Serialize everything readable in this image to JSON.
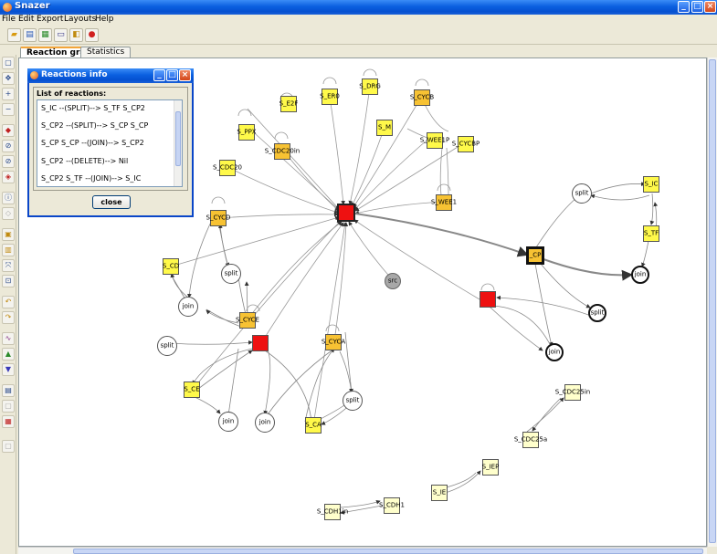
{
  "window": {
    "title": "Snazer"
  },
  "menu": [
    "File",
    "Edit",
    "Export",
    "Layouts",
    "Help"
  ],
  "tabs": [
    {
      "label": "Reaction graph",
      "active": true
    },
    {
      "label": "Statistics",
      "active": false
    }
  ],
  "dialog": {
    "title": "Reactions info",
    "list_label": "List of reactions:",
    "reactions": [
      "S_IC --(SPLIT)--> S_TF S_CP2",
      "S_CP2 --(SPLIT)--> S_CP S_CP",
      "S_CP S_CP --(JOIN)--> S_CP2",
      "S_CP2 --(DELETE)--> Nil",
      "S_CP2 S_TF --(JOIN)--> S_IC"
    ],
    "close_label": "close"
  },
  "graph": {
    "labels": {
      "S_E2F": "S_E2F",
      "S_ER0": "S_ER0",
      "S_DRG": "S_DRG",
      "S_CYCB": "S_CYCB",
      "S_M": "S_M",
      "S_PPX": "S_PPX",
      "S_CDC20in": "S_CDC20in",
      "S_WEE1P": "S_WEE1P",
      "S_CYCBP": "S_CYCBP",
      "S_CDC20": "S_CDC20",
      "S_WEE1": "S_WEE1",
      "S_IC": "S_IC",
      "S_TF": "S_TF",
      "S_CP": "_CP",
      "S_CYCD": "S_CYCD",
      "S_CD": "S_CD",
      "S_CYCE": "S_CYCE",
      "S_CYCA": "S_CYCA",
      "S_CE": "S_CE",
      "S_CA": "S_CA",
      "S_CDC25in": "S_CDC25in",
      "S_CDC25a": "S_CDC25a",
      "S_IEP": "S_IEP",
      "S_IE": "S_IE",
      "S_CDH1in": "S_CDH1in",
      "S_CDH1": "S_CDH1",
      "split": "split",
      "join": "join",
      "src": "src"
    }
  }
}
